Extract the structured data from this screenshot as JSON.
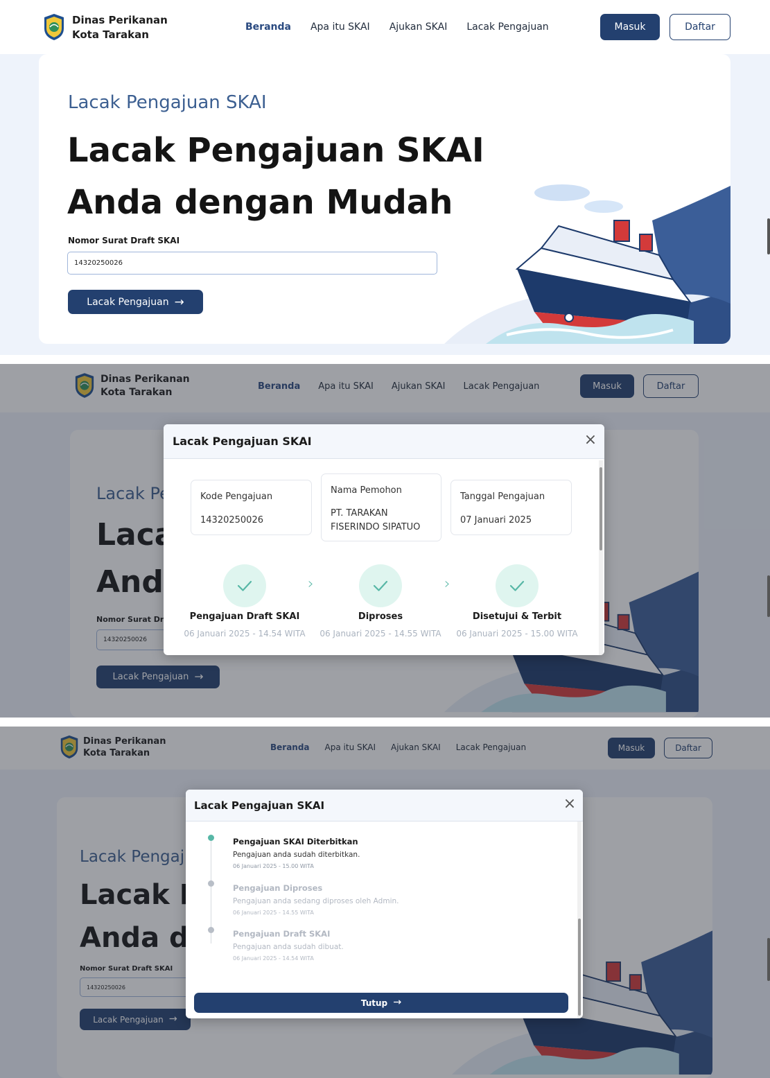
{
  "header": {
    "brand_line1": "Dinas Perikanan",
    "brand_line2": "Kota Tarakan",
    "nav": [
      "Beranda",
      "Apa itu SKAI",
      "Ajukan SKAI",
      "Lacak Pengajuan"
    ],
    "login": "Masuk",
    "register": "Daftar"
  },
  "hero": {
    "subtitle": "Lacak Pengajuan SKAI",
    "headline_line1": "Lacak Pengajuan SKAI",
    "headline_line2": "Anda dengan Mudah",
    "field_label": "Nomor Surat Draft SKAI",
    "field_value": "14320250026",
    "button": "Lacak Pengajuan"
  },
  "modal": {
    "title": "Lacak Pengajuan SKAI",
    "cards": [
      {
        "label": "Kode Pengajuan",
        "value_line1": "14320250026",
        "value_line2": ""
      },
      {
        "label": "Nama Pemohon",
        "value_line1": "PT. TARAKAN",
        "value_line2": "FISERINDO SIPATUO"
      },
      {
        "label": "Tanggal Pengajuan",
        "value_line1": "07 Januari 2025",
        "value_line2": ""
      }
    ],
    "steps": [
      {
        "name": "Pengajuan Draft SKAI",
        "time": "06 Januari 2025 - 14.54 WITA"
      },
      {
        "name": "Diproses",
        "time": "06 Januari 2025 - 14.55 WITA"
      },
      {
        "name": "Disetujui & Terbit",
        "time": "06 Januari 2025 - 15.00 WITA"
      }
    ],
    "timeline": [
      {
        "title": "Pengajuan SKAI Diterbitkan",
        "desc": "Pengajuan anda sudah diterbitkan.",
        "time": "06 Januari 2025 - 15.00 WITA"
      },
      {
        "title": "Pengajuan Diproses",
        "desc": "Pengajuan anda sedang diproses oleh Admin.",
        "time": "06 Januari 2025 - 14.55 WITA"
      },
      {
        "title": "Pengajuan Draft SKAI",
        "desc": "Pengajuan anda sudah dibuat.",
        "time": "06 Januari 2025 - 14.54 WITA"
      }
    ],
    "close_button": "Tutup"
  },
  "colors": {
    "primary": "#23406f",
    "subtitle": "#3c5f91",
    "success": "#57b7a6",
    "success_bg": "#dff5ef",
    "muted": "#aab3bf"
  }
}
